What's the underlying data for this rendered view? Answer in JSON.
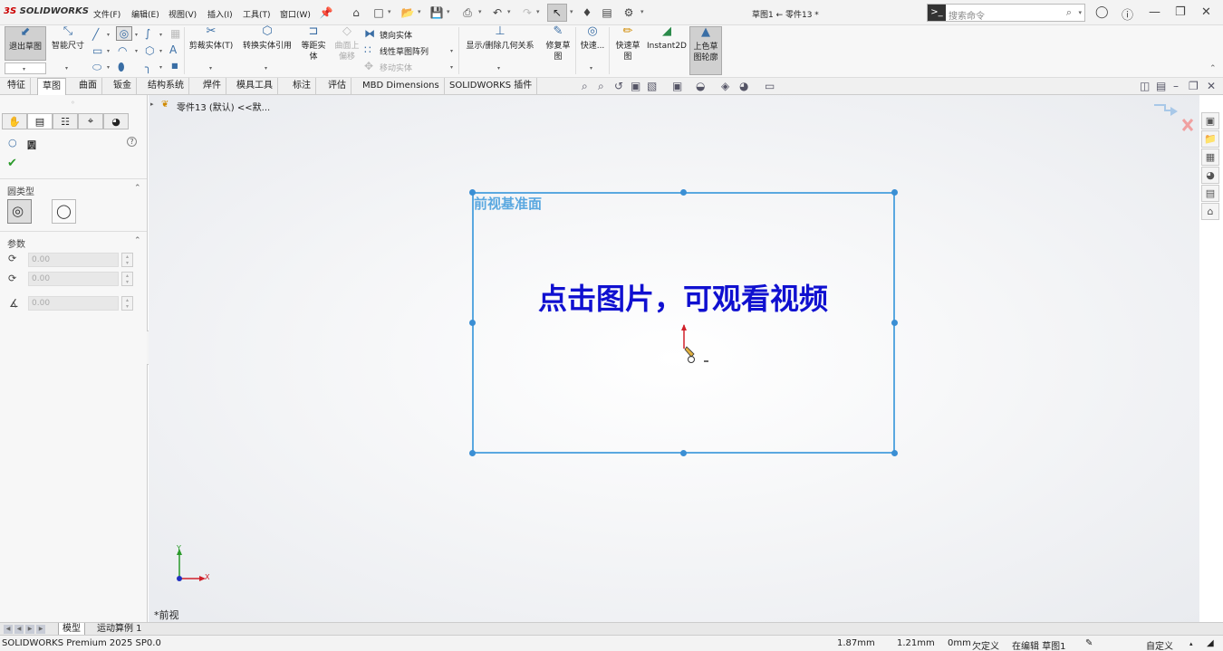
{
  "app": {
    "logo_prefix": "3S",
    "logo_name": "SOLIDWORKS",
    "doc_title": "草图1 ← 零件13 *"
  },
  "menu": [
    "文件(F)",
    "编辑(E)",
    "视图(V)",
    "插入(I)",
    "工具(T)",
    "窗口(W)"
  ],
  "search": {
    "placeholder": "搜索命令",
    "term_icon": ">_"
  },
  "ribbon": {
    "exit_sketch": "退出草图",
    "smart_dim": "智能尺寸",
    "trim": "剪裁实体(T)",
    "convert": "转换实体引用",
    "offset": "等距实",
    "offset2": "体",
    "offset_surf": "曲面上",
    "offset_surf2": "偏移",
    "mirror": "镜向实体",
    "linear_pattern": "线性草图阵列",
    "move": "移动实体",
    "show_rel": "显示/删除几何关系",
    "repair": "修复草",
    "repair2": "图",
    "quick_snap": "快速...",
    "rapid_sketch": "快速草",
    "rapid_sketch2": "图",
    "instant2d": "Instant2D",
    "shaded": "上色草",
    "shaded2": "图轮廓"
  },
  "tabs": [
    "特征",
    "草图",
    "曲面",
    "钣金",
    "结构系统",
    "焊件",
    "模具工具",
    "标注",
    "评估",
    "MBD Dimensions",
    "SOLIDWORKS 插件"
  ],
  "active_tab": "草图",
  "panel": {
    "feature_name": "圆",
    "help": "?",
    "section_type": "圆类型",
    "section_params": "参数",
    "param_x": "0.00",
    "param_y": "0.00",
    "param_r": "0.00"
  },
  "viewport": {
    "tree_node": "零件13 (默认) <<默...",
    "plane_label": "前视基准面",
    "overlay_text": "点击图片，可观看视频",
    "view_name": "*前视",
    "axis_x": "X",
    "axis_y": "Y"
  },
  "bottom_tabs": [
    "模型",
    "运动算例 1"
  ],
  "status": {
    "product": "SOLIDWORKS Premium 2025 SP0.0",
    "x": "1.87mm",
    "y": "1.21mm",
    "z": "0mm",
    "defined": "欠定义",
    "editing": "在编辑 草图1",
    "units": "自定义"
  },
  "colors": {
    "plane": "#5aa8e0",
    "overlay": "#1010d0",
    "accent": "#3a6ea5"
  }
}
